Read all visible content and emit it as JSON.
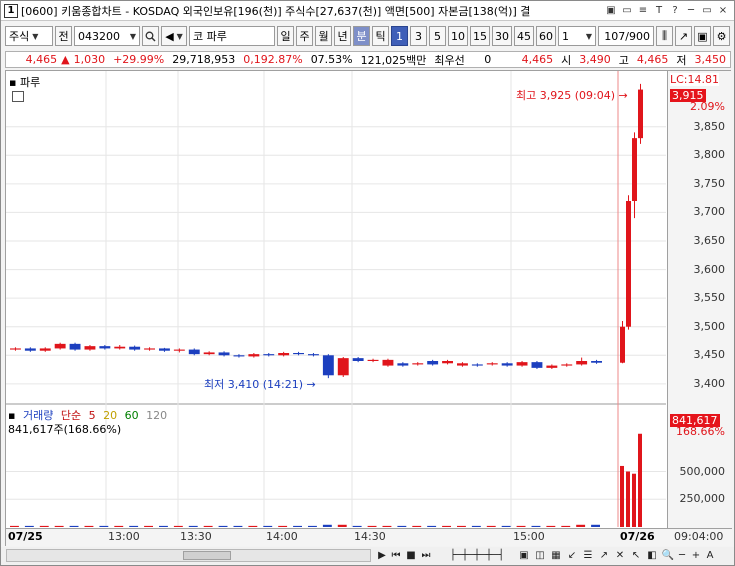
{
  "window": {
    "title": "[0600] 키움종합차트 - KOSDAQ 외국인보유[196(천)] 주식수[27,637(천)] 액면[500] 자본금[138(억)] 결",
    "controls": [
      "▣",
      "▭",
      "≡",
      "T",
      "?",
      "─",
      "▭",
      "×"
    ]
  },
  "toolbar": {
    "market": "주식",
    "prev_label": "전",
    "code": "043200",
    "name": "코 파루",
    "periods": [
      "일",
      "주",
      "월",
      "년",
      "분",
      "틱"
    ],
    "active_period": "분",
    "intervals": [
      "1",
      "3",
      "5",
      "10",
      "15",
      "30",
      "45",
      "60"
    ],
    "active_interval": "1",
    "count_select": "1",
    "page_count": "107/900"
  },
  "quote": {
    "price": "4,465",
    "change": "1,030",
    "change_rate": "+29.99%",
    "volume": "29,718,953",
    "volume_rate": "0,192.87%",
    "turnover": "07.53%",
    "amount": "121,025백만",
    "priority_label": "최우선",
    "priority_value": "0",
    "last": "4,465",
    "open_label": "시",
    "open": "3,490",
    "high_label": "고",
    "high": "4,465",
    "low_label": "저",
    "low": "3,450"
  },
  "chart": {
    "stock_label": "파루",
    "lc_label": "LC:14.81",
    "current_price_tag": "3,915",
    "current_pct": "2.09%",
    "high_annotation": "최고 3,925 (09:04)",
    "low_annotation": "최저 3,410 (14:21)",
    "volume_legend": [
      "거래량",
      "단순",
      "5",
      "20",
      "60",
      "120"
    ],
    "volume_value": "841,617주(168.66%)",
    "volume_tag": "841,617",
    "volume_pct": "168.66%",
    "time_readout": "09:04:00"
  },
  "chart_data": {
    "type": "candlestick",
    "price_ylim": [
      3370,
      3930
    ],
    "price_yticks": [
      "3,850",
      "3,800",
      "3,750",
      "3,700",
      "3,650",
      "3,600",
      "3,550",
      "3,500",
      "3,450",
      "3,400"
    ],
    "volume_yticks": [
      "500,000",
      "250,000"
    ],
    "x_labels": [
      "07/25",
      "13:00",
      "13:30",
      "14:00",
      "14:30",
      "15:00",
      "07/26"
    ],
    "candles": [
      {
        "o": 3460,
        "c": 3462,
        "h": 3464,
        "l": 3458,
        "up": true
      },
      {
        "o": 3462,
        "c": 3458,
        "h": 3464,
        "l": 3456,
        "up": false
      },
      {
        "o": 3458,
        "c": 3462,
        "h": 3464,
        "l": 3456,
        "up": true
      },
      {
        "o": 3462,
        "c": 3470,
        "h": 3472,
        "l": 3460,
        "up": true
      },
      {
        "o": 3470,
        "c": 3460,
        "h": 3472,
        "l": 3458,
        "up": false
      },
      {
        "o": 3460,
        "c": 3466,
        "h": 3468,
        "l": 3458,
        "up": true
      },
      {
        "o": 3466,
        "c": 3462,
        "h": 3468,
        "l": 3460,
        "up": false
      },
      {
        "o": 3462,
        "c": 3465,
        "h": 3468,
        "l": 3460,
        "up": true
      },
      {
        "o": 3465,
        "c": 3460,
        "h": 3467,
        "l": 3458,
        "up": false
      },
      {
        "o": 3460,
        "c": 3462,
        "h": 3464,
        "l": 3458,
        "up": true
      },
      {
        "o": 3462,
        "c": 3458,
        "h": 3463,
        "l": 3456,
        "up": false
      },
      {
        "o": 3458,
        "c": 3460,
        "h": 3462,
        "l": 3455,
        "up": true
      },
      {
        "o": 3460,
        "c": 3452,
        "h": 3462,
        "l": 3450,
        "up": false
      },
      {
        "o": 3452,
        "c": 3455,
        "h": 3457,
        "l": 3450,
        "up": true
      },
      {
        "o": 3455,
        "c": 3450,
        "h": 3457,
        "l": 3448,
        "up": false
      },
      {
        "o": 3450,
        "c": 3448,
        "h": 3452,
        "l": 3446,
        "up": false
      },
      {
        "o": 3448,
        "c": 3452,
        "h": 3454,
        "l": 3446,
        "up": true
      },
      {
        "o": 3452,
        "c": 3450,
        "h": 3454,
        "l": 3448,
        "up": false
      },
      {
        "o": 3450,
        "c": 3454,
        "h": 3456,
        "l": 3448,
        "up": true
      },
      {
        "o": 3454,
        "c": 3452,
        "h": 3456,
        "l": 3450,
        "up": false
      },
      {
        "o": 3452,
        "c": 3450,
        "h": 3454,
        "l": 3448,
        "up": false
      },
      {
        "o": 3450,
        "c": 3415,
        "h": 3452,
        "l": 3410,
        "up": false
      },
      {
        "o": 3415,
        "c": 3445,
        "h": 3447,
        "l": 3412,
        "up": true
      },
      {
        "o": 3445,
        "c": 3440,
        "h": 3447,
        "l": 3438,
        "up": false
      },
      {
        "o": 3440,
        "c": 3442,
        "h": 3444,
        "l": 3438,
        "up": true
      },
      {
        "o": 3442,
        "c": 3432,
        "h": 3444,
        "l": 3430,
        "up": true
      },
      {
        "o": 3432,
        "c": 3436,
        "h": 3438,
        "l": 3430,
        "up": false
      },
      {
        "o": 3436,
        "c": 3434,
        "h": 3438,
        "l": 3432,
        "up": true
      },
      {
        "o": 3434,
        "c": 3440,
        "h": 3442,
        "l": 3432,
        "up": false
      },
      {
        "o": 3440,
        "c": 3436,
        "h": 3442,
        "l": 3434,
        "up": true
      },
      {
        "o": 3436,
        "c": 3432,
        "h": 3438,
        "l": 3430,
        "up": true
      },
      {
        "o": 3432,
        "c": 3434,
        "h": 3436,
        "l": 3430,
        "up": false
      },
      {
        "o": 3434,
        "c": 3436,
        "h": 3438,
        "l": 3432,
        "up": true
      },
      {
        "o": 3436,
        "c": 3432,
        "h": 3438,
        "l": 3430,
        "up": false
      },
      {
        "o": 3432,
        "c": 3438,
        "h": 3440,
        "l": 3430,
        "up": true
      },
      {
        "o": 3438,
        "c": 3428,
        "h": 3440,
        "l": 3426,
        "up": false
      },
      {
        "o": 3428,
        "c": 3432,
        "h": 3434,
        "l": 3426,
        "up": true
      },
      {
        "o": 3432,
        "c": 3434,
        "h": 3436,
        "l": 3430,
        "up": true
      },
      {
        "o": 3434,
        "c": 3440,
        "h": 3446,
        "l": 3432,
        "up": true
      },
      {
        "o": 3440,
        "c": 3437,
        "h": 3442,
        "l": 3435,
        "up": false
      },
      {
        "o": 3437,
        "c": 3500,
        "h": 3510,
        "l": 3436,
        "up": true
      },
      {
        "o": 3500,
        "c": 3720,
        "h": 3730,
        "l": 3495,
        "up": true
      },
      {
        "o": 3720,
        "c": 3830,
        "h": 3840,
        "l": 3690,
        "up": true
      },
      {
        "o": 3830,
        "c": 3915,
        "h": 3925,
        "l": 3820,
        "up": true
      }
    ],
    "volumes": [
      0.01,
      0.01,
      0.01,
      0.01,
      0.01,
      0.01,
      0.01,
      0.01,
      0.01,
      0.01,
      0.01,
      0.01,
      0.01,
      0.01,
      0.01,
      0.01,
      0.01,
      0.01,
      0.01,
      0.01,
      0.01,
      0.02,
      0.02,
      0.01,
      0.01,
      0.01,
      0.01,
      0.01,
      0.01,
      0.01,
      0.01,
      0.01,
      0.01,
      0.01,
      0.01,
      0.01,
      0.01,
      0.01,
      0.02,
      0.02,
      0.55,
      0.5,
      0.48,
      0.84
    ]
  }
}
